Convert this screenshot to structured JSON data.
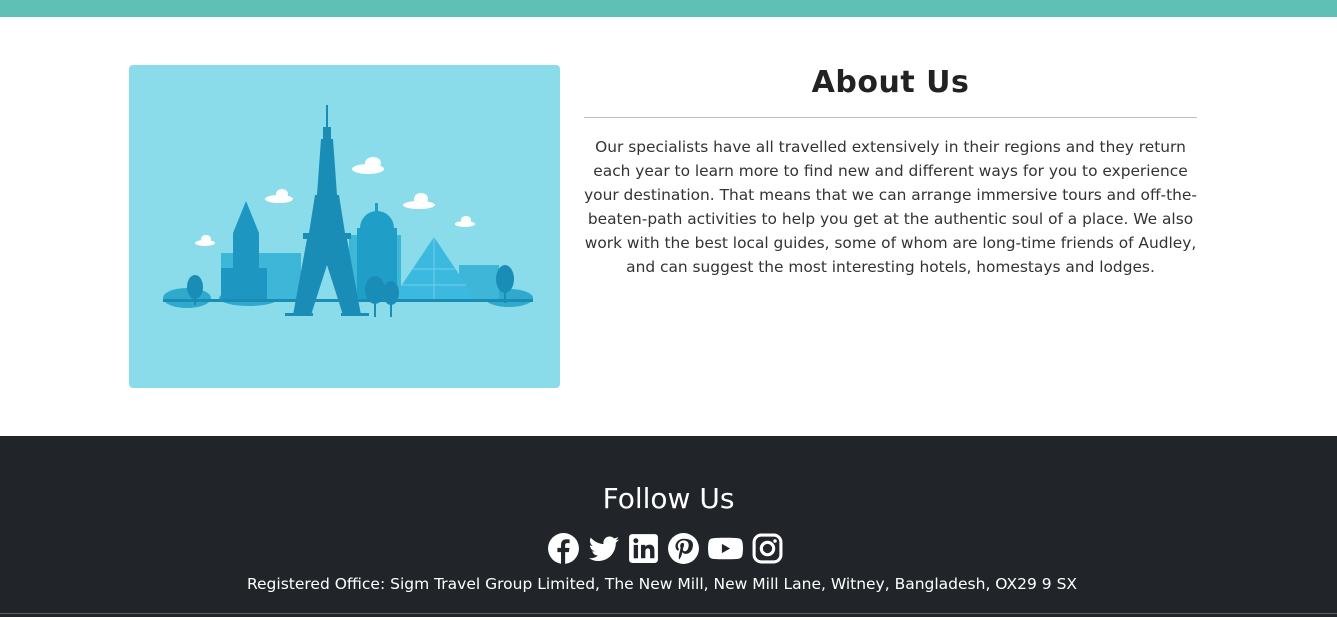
{
  "about": {
    "title": "About Us",
    "text": "Our specialists have all travelled extensively in their regions and they return each year to learn more to find new and different ways for you to experience your destination. That means that we can arrange immersive tours and off-the-beaten-path activities to help you get at the authentic soul of a place. We also work with the best local guides, some of whom are long-time friends of Audley, and can suggest the most interesting hotels, homestays and lodges.",
    "image_icon": "paris-skyline-illustration"
  },
  "footer": {
    "title": "Follow Us",
    "social": [
      "facebook-icon",
      "twitter-icon",
      "linkedin-icon",
      "pinterest-icon",
      "youtube-icon",
      "instagram-icon"
    ],
    "address": "Registered Office: Sigm Travel Group Limited, The New Mill, New Mill Lane, Witney, Bangladesh, OX29 9 SX"
  },
  "colors": {
    "top_bar": "#5fc0b5",
    "image_bg": "#8bdcea",
    "footer_bg": "#212529"
  }
}
